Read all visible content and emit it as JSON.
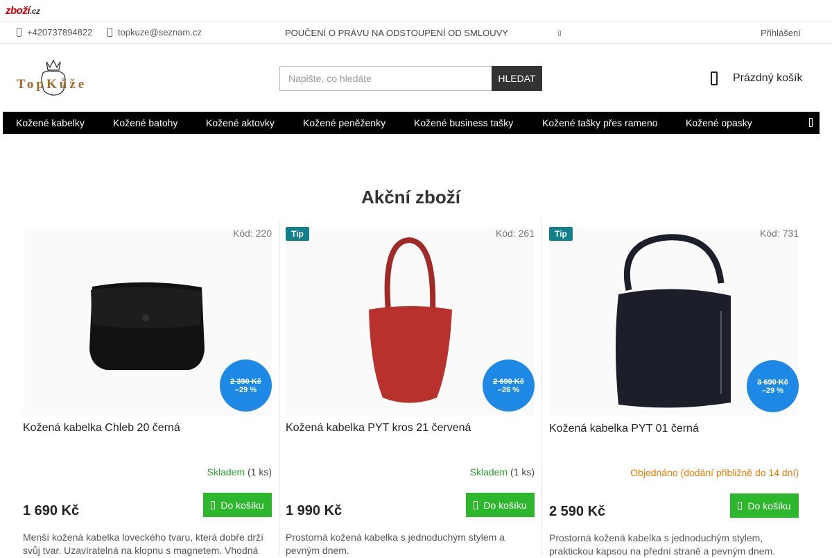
{
  "zbozi": {
    "logo": "zboží",
    "logo_suffix": ".cz"
  },
  "contact": {
    "phone": "+420737894822",
    "email": "topkuze@seznam.cz",
    "legal_link": "POUČENÍ O PRÁVU NA ODSTOUPENÍ OD SMLOUVY",
    "login": "Přihlášení"
  },
  "header": {
    "logo_text": "TopKůže",
    "search_placeholder": "Napište, co hledáte",
    "search_button": "HLEDAT",
    "cart_label": "Prázdný košík"
  },
  "nav": {
    "items": [
      "Kožené kabelky",
      "Kožené batohy",
      "Kožené aktovky",
      "Kožené peněženky",
      "Kožené business tašky",
      "Kožené tašky přes rameno",
      "Kožené opasky"
    ]
  },
  "section": {
    "title": "Akční zboží"
  },
  "products": [
    {
      "tip": "",
      "code": "Kód: 220",
      "old_price": "2 390 Kč",
      "discount": "–29 %",
      "name": "Kožená kabelka Chleb 20 černá",
      "stock_label": "Skladem",
      "stock_qty": "(1 ks)",
      "price": "1 690 Kč",
      "buy_label": "Do košíku",
      "description": "Menší kožená kabelka loveckého tvaru, která dobře drží svůj tvar. Uzavíratelná na klopnu s magnetem. Vhodná",
      "image_color": "#111111"
    },
    {
      "tip": "Tip",
      "code": "Kód: 261",
      "old_price": "2 690 Kč",
      "discount": "–26 %",
      "name": "Kožená kabelka PYT kros 21 červená",
      "stock_label": "Skladem",
      "stock_qty": "(1 ks)",
      "price": "1 990 Kč",
      "buy_label": "Do košíku",
      "description": "Prostorná kožená kabelka s jednoduchým stylem a pevným dnem.",
      "image_color": "#b8312c"
    },
    {
      "tip": "Tip",
      "code": "Kód: 731",
      "old_price": "3 690 Kč",
      "discount": "–29 %",
      "name": "Kožená kabelka PYT 01 černá",
      "stock_label": "Objednáno (dodání přibližně do 14 dní)",
      "stock_qty": "",
      "price": "2 590 Kč",
      "buy_label": "Do košíku",
      "description": "Prostorná kožená kabelka s jednoduchým stylem, praktickou kapsou na přední straně a pevným dnem.",
      "image_color": "#1c1f29"
    }
  ],
  "colors": {
    "nav_bg": "#000000",
    "buy_green": "#2db72d",
    "discount_blue": "#1e88e5",
    "tip_teal": "#117f8c",
    "ordered_orange": "#ec7a00"
  }
}
